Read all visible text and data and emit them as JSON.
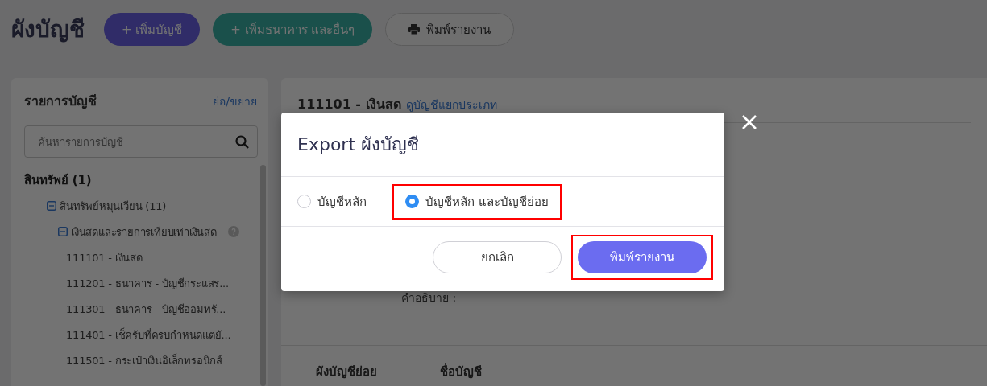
{
  "header": {
    "title": "ผังบัญชี",
    "buttons": [
      {
        "kind": "primary",
        "label": "+ เพิ่มบัญชี"
      },
      {
        "kind": "teal",
        "label": "+ เพิ่มธนาคาร และอื่นๆ"
      },
      {
        "kind": "print",
        "label": "พิมพ์รายงาน"
      }
    ]
  },
  "sidebar": {
    "title": "รายการบัญชี",
    "toggle_link": "ย่อ/ขยาย",
    "search": {
      "placeholder": "ค้นหารายการบัญชี"
    },
    "tree": [
      {
        "label": "สินทรัพย์ (1)",
        "children": [
          {
            "label": "สินทรัพย์หมุนเวียน (11)",
            "expanded": true,
            "children": [
              {
                "label": "เงินสดและรายการเทียบเท่าเงินสด",
                "expanded": true,
                "help": true,
                "children": [
                  {
                    "label": "111101 - เงินสด"
                  },
                  {
                    "label": "111201 - ธนาคาร - บัญชีกระแสร..."
                  },
                  {
                    "label": "111301 - ธนาคาร - บัญชีออมทรั..."
                  },
                  {
                    "label": "111401 - เช็ครับที่ครบกำหนดแต่ยั..."
                  },
                  {
                    "label": "111501 - กระเป๋าเงินอิเล็กทรอนิกส์"
                  }
                ]
              }
            ]
          }
        ]
      }
    ]
  },
  "detail": {
    "title": "111101 - เงินสด",
    "link": "ดูบัญชีแยกประเภท",
    "description_label": "คำอธิบาย :",
    "columns": [
      "ผังบัญชีย่อย",
      "ชื่อบัญชี"
    ]
  },
  "dialog": {
    "title": "Export ผังบัญชี",
    "options": [
      {
        "label": "บัญชีหลัก",
        "selected": false,
        "highlighted": false
      },
      {
        "label": "บัญชีหลัก และบัญชีย่อย",
        "selected": true,
        "highlighted": true
      }
    ],
    "buttons": [
      {
        "kind": "secondary",
        "label": "ยกเลิก",
        "highlighted": false
      },
      {
        "kind": "primary",
        "label": "พิมพ์รายงาน",
        "highlighted": true
      }
    ]
  }
}
